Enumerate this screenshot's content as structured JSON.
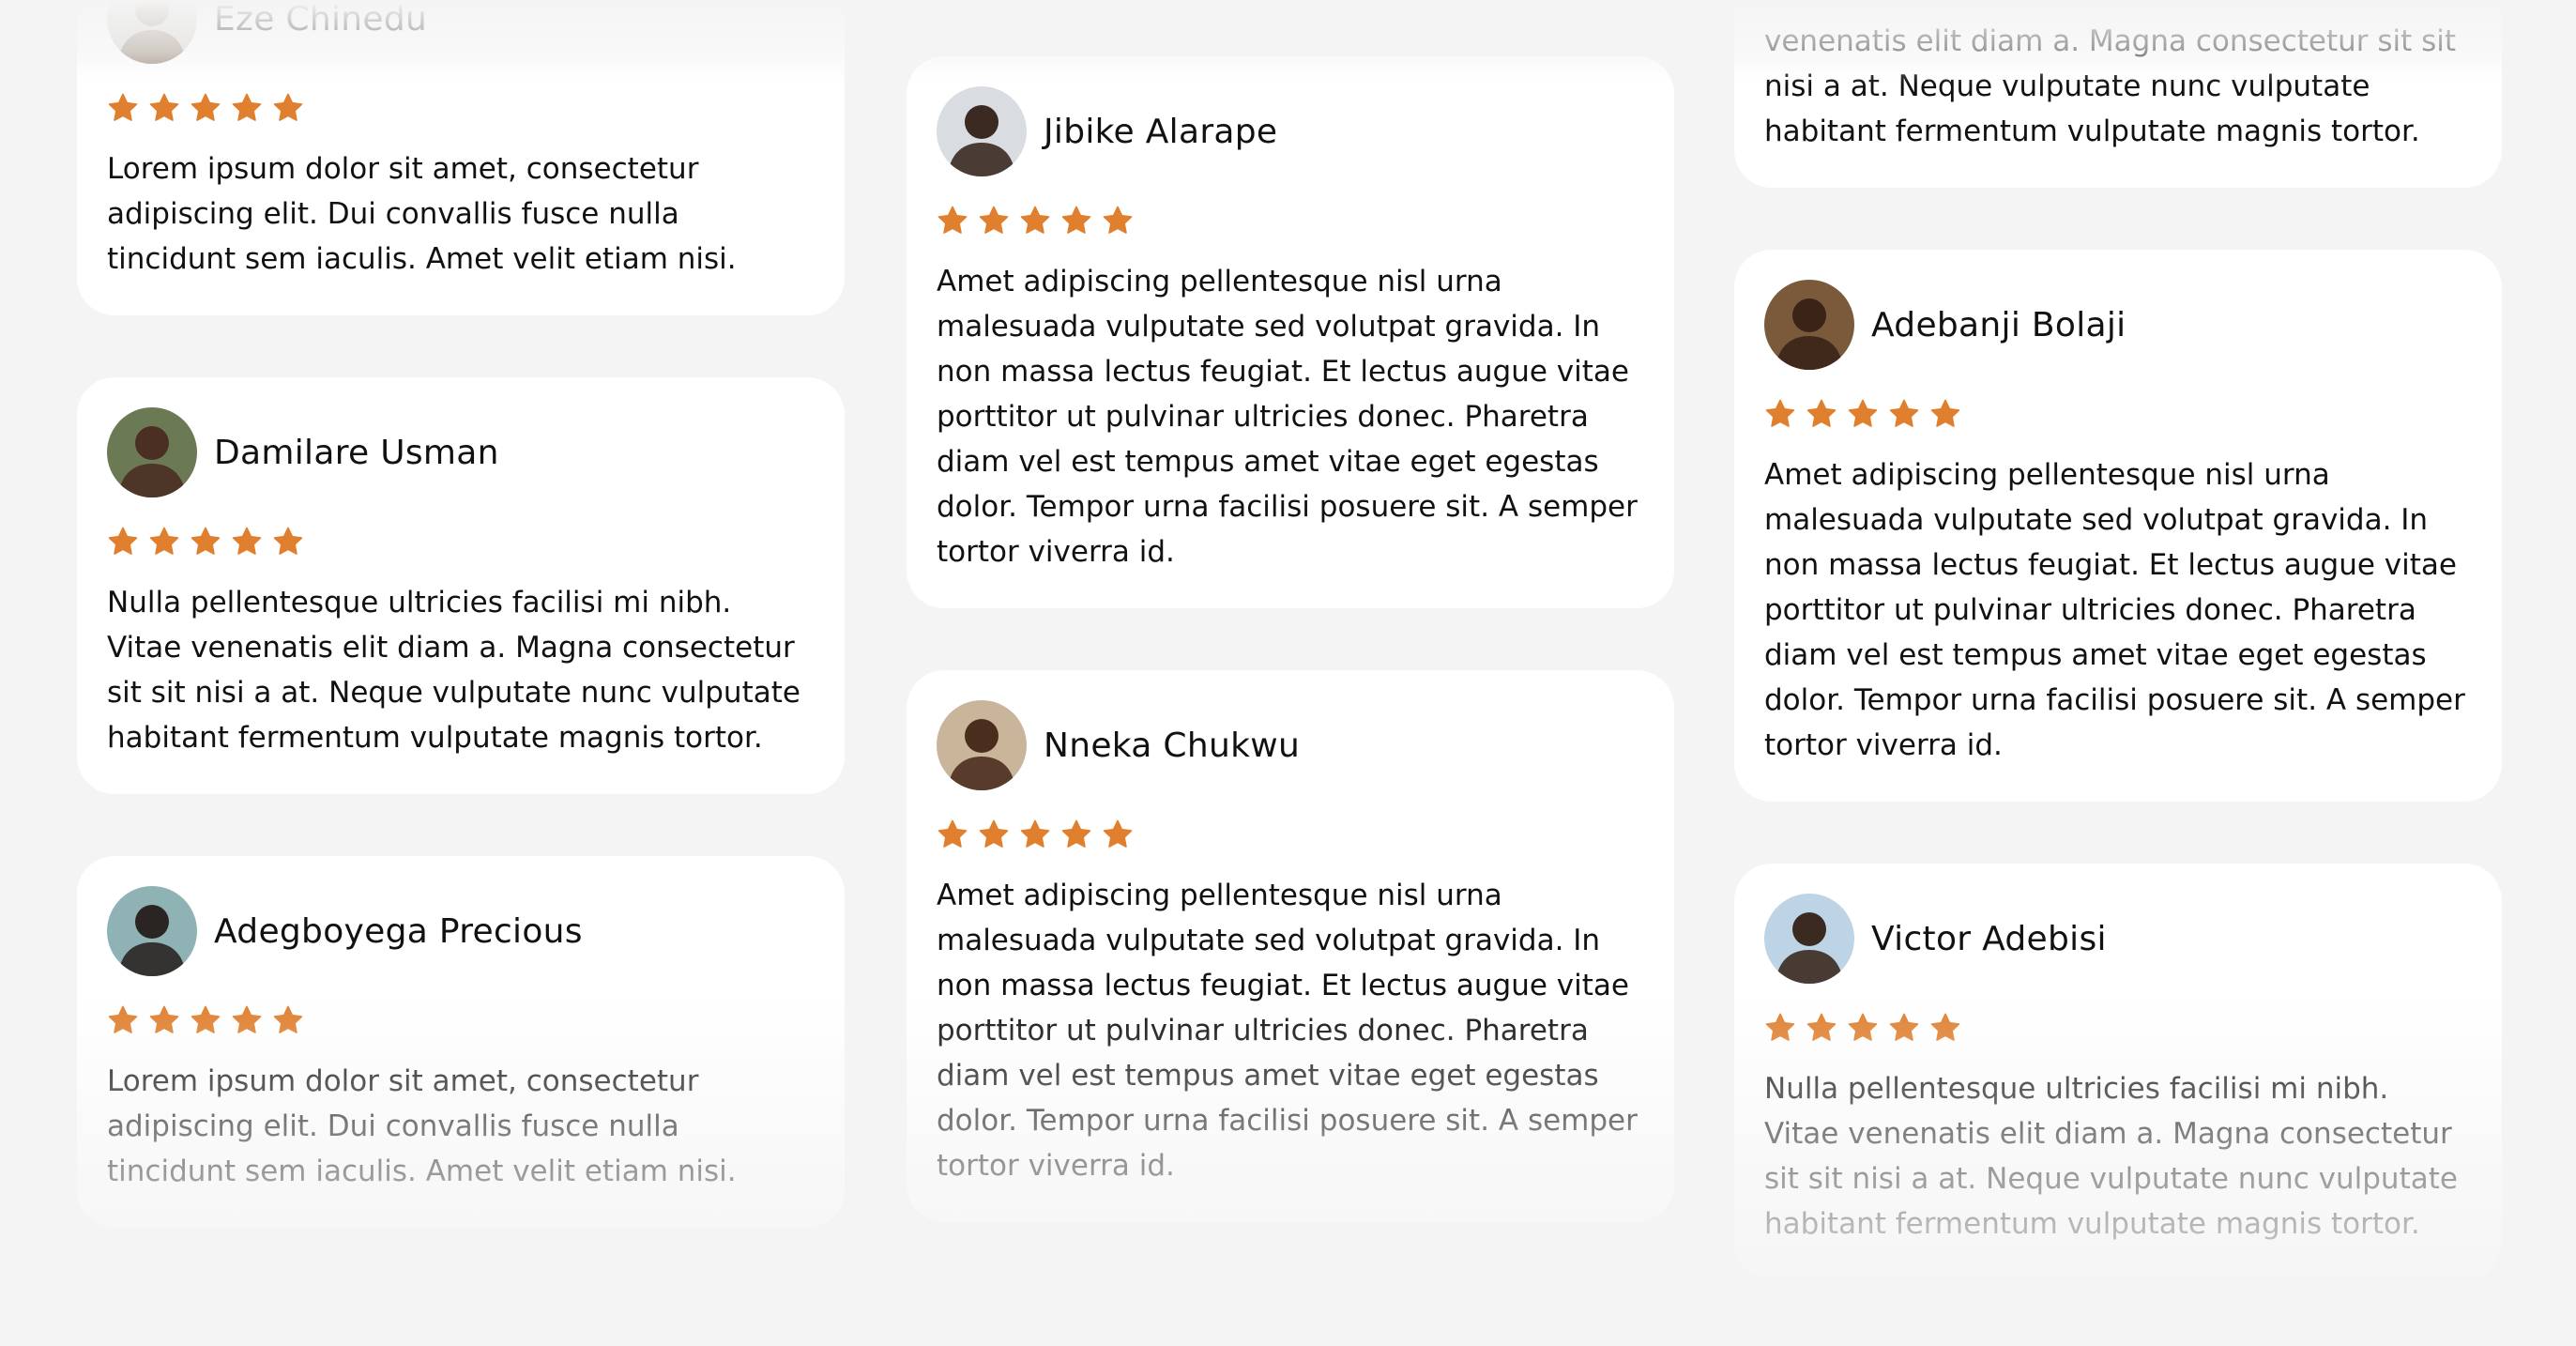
{
  "accent": "#e07f2e",
  "columns": [
    [
      {
        "name": "Eze Chinedu",
        "stars": 5,
        "text": "Lorem ipsum dolor sit amet, consectetur adipiscing elit. Dui convallis fusce nulla tincidunt sem iaculis. Amet velit etiam nisi."
      },
      {
        "name": "Damilare Usman",
        "stars": 5,
        "text": "Nulla pellentesque ultricies facilisi mi nibh. Vitae venenatis elit diam a. Magna consectetur sit sit nisi a at. Neque vulputate nunc vulputate habitant fermentum vulputate magnis tortor."
      },
      {
        "name": "Adegboyega Precious",
        "stars": 5,
        "text": "Lorem ipsum dolor sit amet, consectetur adipiscing elit. Dui convallis fusce nulla tincidunt sem iaculis. Amet velit etiam nisi."
      }
    ],
    [
      {
        "name": "Jibike Alarape",
        "stars": 5,
        "text": "Amet adipiscing pellentesque nisl urna malesuada vulputate sed volutpat gravida. In non massa lectus feugiat. Et lectus augue vitae porttitor ut pulvinar ultricies donec. Pharetra diam vel est tempus amet vitae eget egestas dolor. Tempor urna facilisi posuere sit. A semper tortor viverra id."
      },
      {
        "name": "Nneka Chukwu",
        "stars": 5,
        "text": "Amet adipiscing pellentesque nisl urna malesuada vulputate sed volutpat gravida. In non massa lectus feugiat. Et lectus augue vitae porttitor ut pulvinar ultricies donec. Pharetra diam vel est tempus amet vitae eget egestas dolor. Tempor urna facilisi posuere sit. A semper tortor viverra id."
      }
    ],
    [
      {
        "name": "",
        "stars": 0,
        "text": "venenatis elit diam a. Magna consectetur sit sit nisi a at. Neque vulputate nunc vulputate habitant fermentum vulputate magnis tortor."
      },
      {
        "name": "Adebanji Bolaji",
        "stars": 5,
        "text": "Amet adipiscing pellentesque nisl urna malesuada vulputate sed volutpat gravida. In non massa lectus feugiat. Et lectus augue vitae porttitor ut pulvinar ultricies donec. Pharetra diam vel est tempus amet vitae eget egestas dolor. Tempor urna facilisi posuere sit. A semper tortor viverra id."
      },
      {
        "name": "Victor Adebisi",
        "stars": 5,
        "text": "Nulla pellentesque ultricies facilisi mi nibh. Vitae venenatis elit diam a. Magna consectetur sit sit nisi a at. Neque vulputate nunc vulputate habitant fermentum vulputate magnis tortor."
      }
    ]
  ],
  "avatar_colors": {
    "Eze Chinedu": [
      "#d8d4cf",
      "#9c8a7a"
    ],
    "Damilare Usman": [
      "#6b7a55",
      "#4a2f22"
    ],
    "Adegboyega Precious": [
      "#8fb3b5",
      "#2a2522"
    ],
    "Jibike Alarape": [
      "#d9dde2",
      "#3a2a22"
    ],
    "Nneka Chukwu": [
      "#c9b59a",
      "#4b2d1e"
    ],
    "Adebanji Bolaji": [
      "#7a5a3a",
      "#3a2418"
    ],
    "Victor Adebisi": [
      "#bcd4e6",
      "#3b2a20"
    ]
  }
}
